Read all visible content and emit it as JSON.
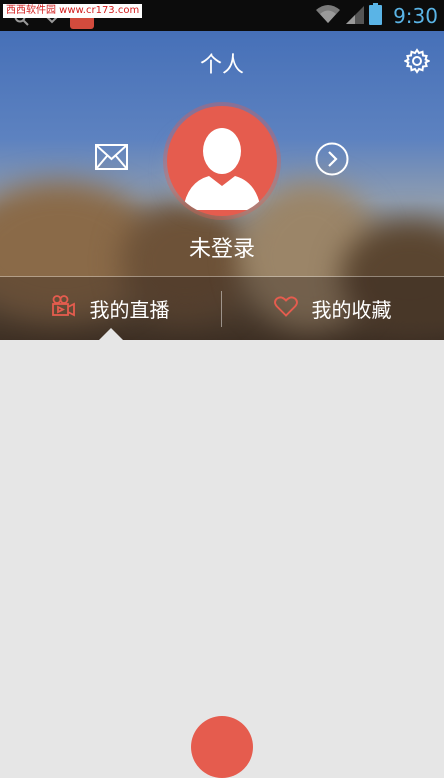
{
  "status_bar": {
    "watermark": "西西软件园 www.cr173.com",
    "time": "9:30"
  },
  "header": {
    "title": "个人",
    "login_label": "未登录"
  },
  "tabs": [
    {
      "label": "我的直播"
    },
    {
      "label": "我的收藏"
    }
  ],
  "colors": {
    "accent": "#e55c4e",
    "clock": "#5ab4e6",
    "content_bg": "#e6e6e6"
  },
  "icons": [
    "settings-gear-icon",
    "mail-icon",
    "arrow-right-circle-icon",
    "avatar-person-icon",
    "video-camera-icon",
    "heart-icon",
    "wifi-icon",
    "signal-icon",
    "battery-icon"
  ]
}
